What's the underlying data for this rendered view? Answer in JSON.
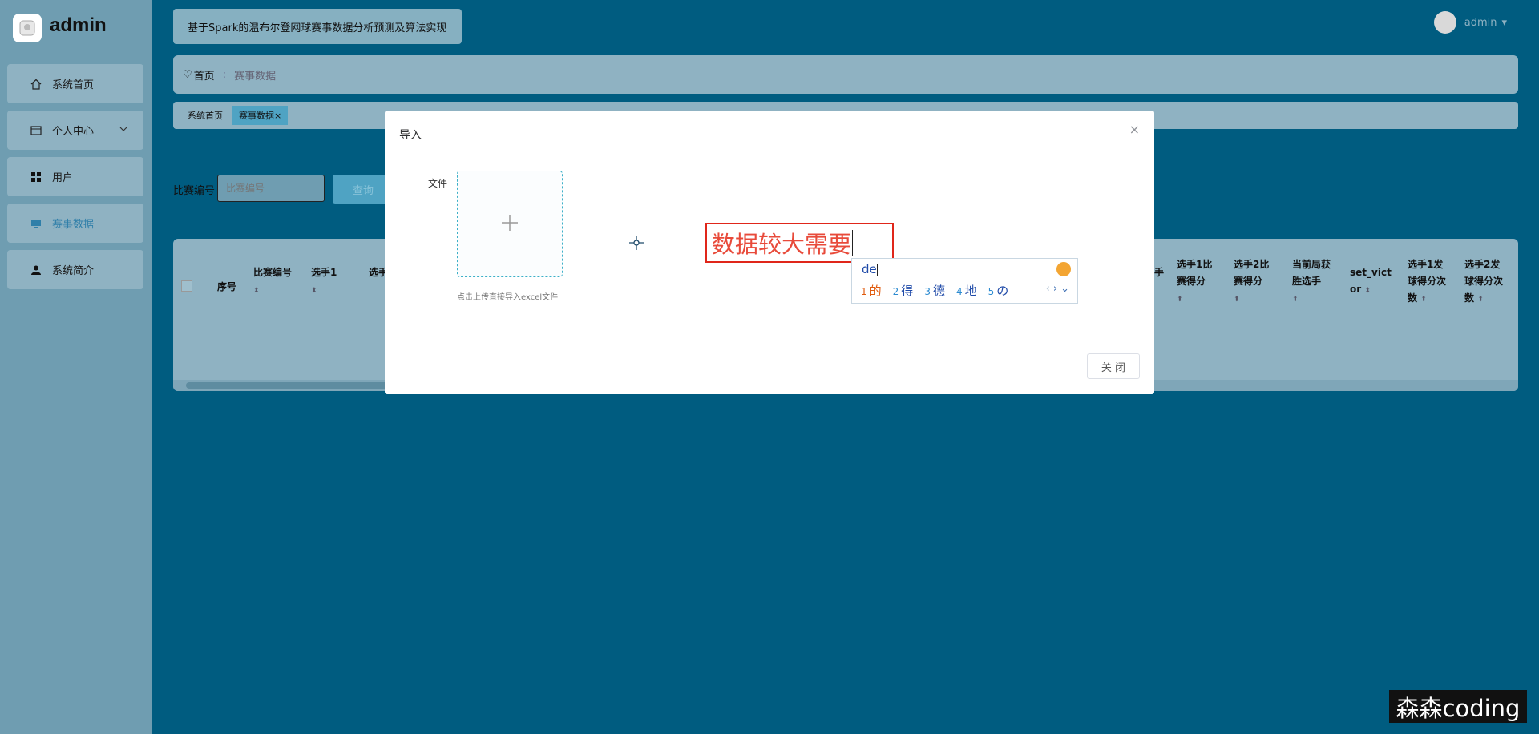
{
  "sidebar": {
    "brand": "admin",
    "items": [
      {
        "label": "系统首页",
        "icon": "home-icon"
      },
      {
        "label": "个人中心",
        "icon": "card-icon"
      },
      {
        "label": "用户",
        "icon": "grid-icon"
      },
      {
        "label": "赛事数据",
        "icon": "monitor-icon",
        "active": true
      },
      {
        "label": "系统简介",
        "icon": "person-icon"
      }
    ]
  },
  "header": {
    "title": "基于Spark的温布尔登网球赛事数据分析预测及算法实现",
    "user": "admin"
  },
  "breadcrumb": {
    "home": "首页",
    "current": "赛事数据"
  },
  "tags": [
    {
      "label": "系统首页"
    },
    {
      "label": "赛事数据",
      "active": true,
      "close": "×"
    }
  ],
  "search": {
    "label": "比赛编号",
    "placeholder": "比赛编号",
    "button": "查询"
  },
  "table": {
    "columns": [
      "序号",
      "比赛编号",
      "选手1",
      "选手",
      "手",
      "选手1比赛得分",
      "选手2比赛得分",
      "当前局获胜选手",
      "set_victor",
      "选手1发球得分次数",
      "选手2发球得分次数"
    ]
  },
  "modal": {
    "title": "导入",
    "close_icon": "×",
    "file_label": "文件",
    "upload_hint": "点击上传直接导入excel文件",
    "close_button": "关 闭"
  },
  "annotation": {
    "text": "数据较大需要"
  },
  "ime": {
    "composition": "de",
    "candidates": [
      {
        "num": "1",
        "text": "的"
      },
      {
        "num": "2",
        "text": "得"
      },
      {
        "num": "3",
        "text": "德"
      },
      {
        "num": "4",
        "text": "地"
      },
      {
        "num": "5",
        "text": "の"
      }
    ]
  },
  "watermark": "森森coding"
}
